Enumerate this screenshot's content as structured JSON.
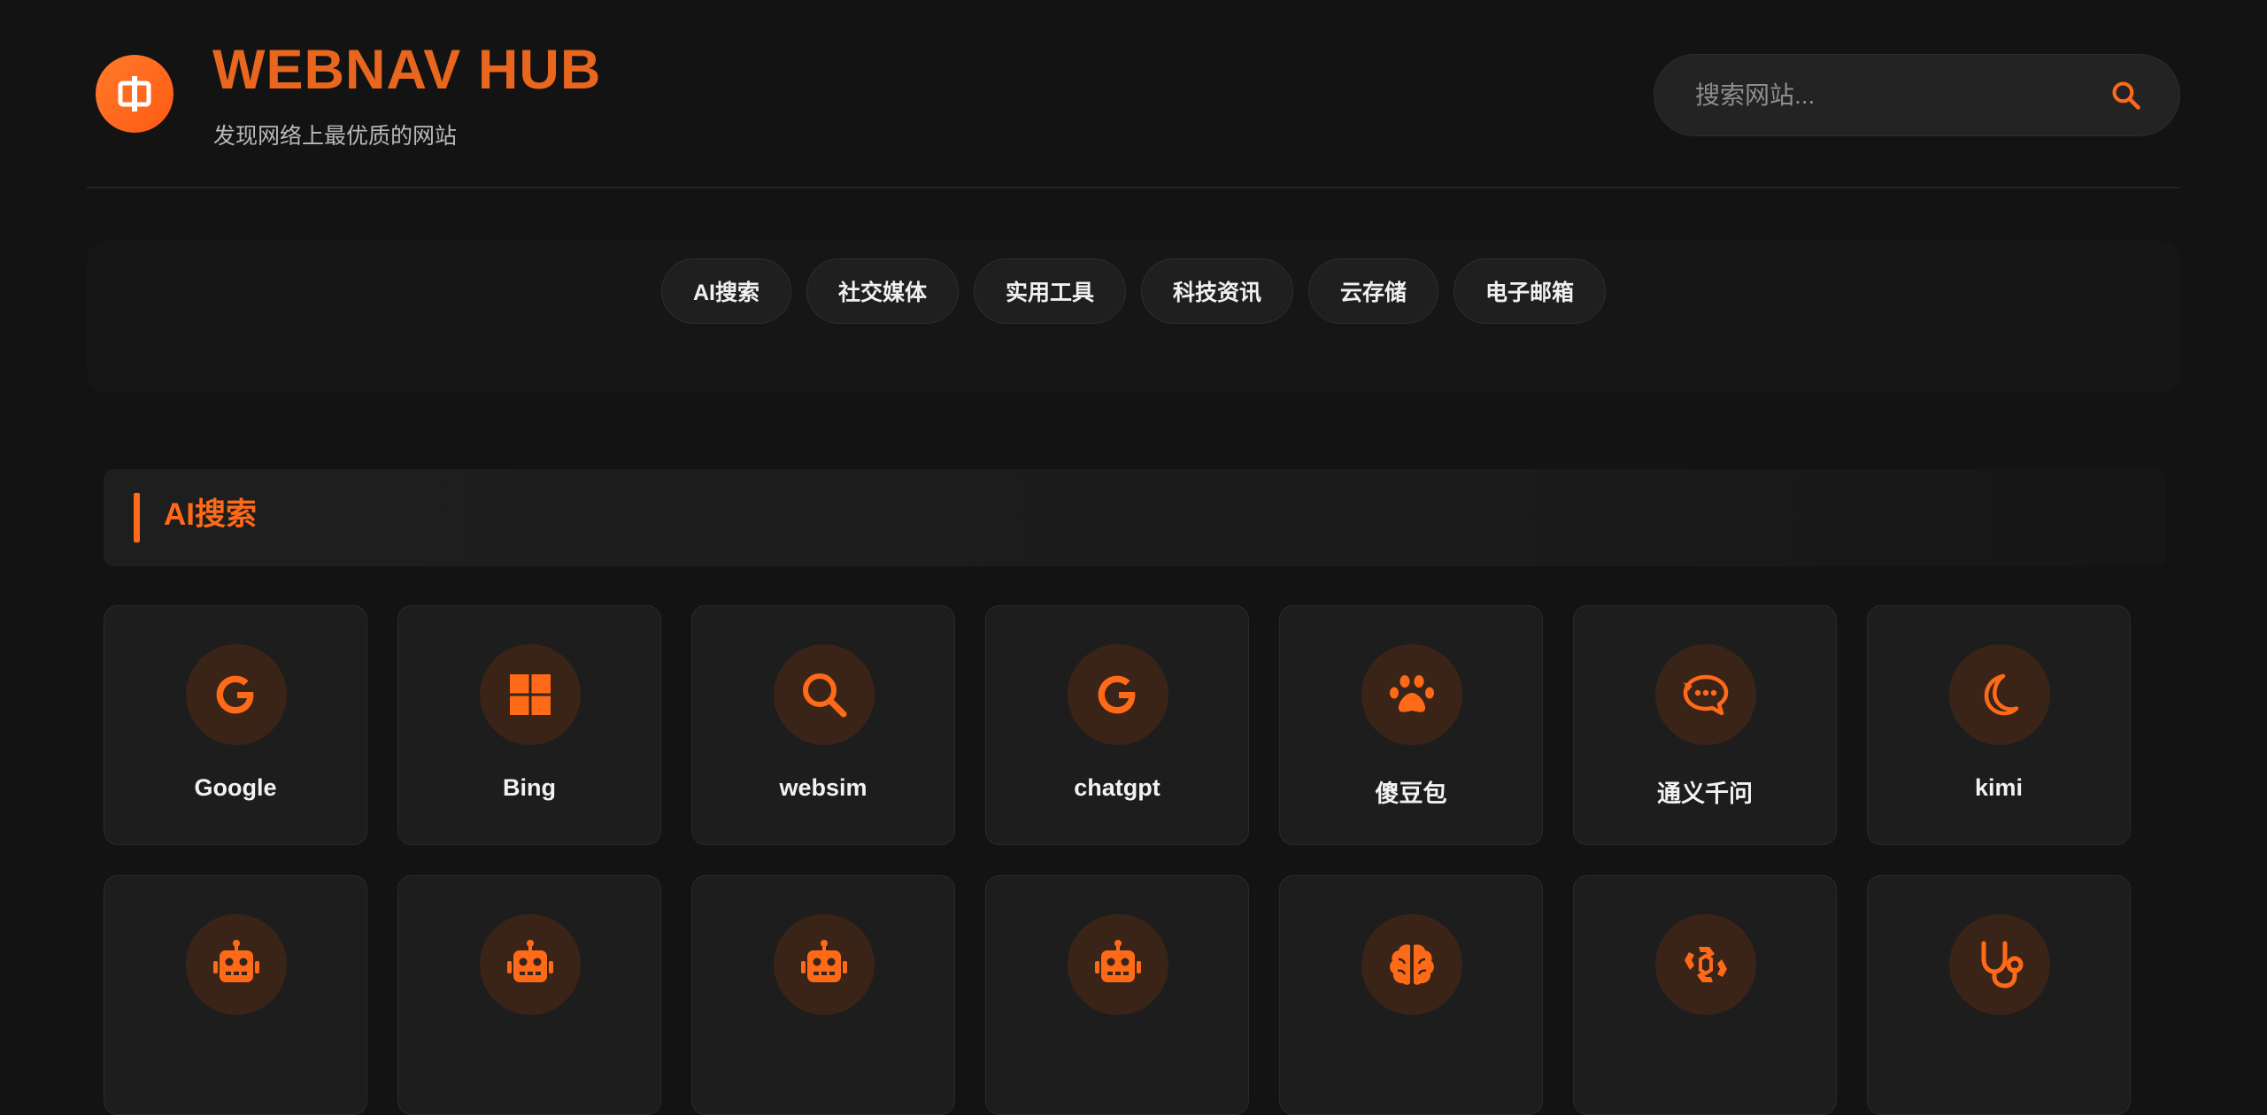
{
  "header": {
    "title": "WEBNAV HUB",
    "subtitle": "发现网络上最优质的网站",
    "logo_icon": "box-plus-icon"
  },
  "search": {
    "placeholder": "搜索网站...",
    "value": "",
    "icon": "search-icon"
  },
  "categories": [
    {
      "label": "AI搜索"
    },
    {
      "label": "社交媒体"
    },
    {
      "label": "实用工具"
    },
    {
      "label": "科技资讯"
    },
    {
      "label": "云存储"
    },
    {
      "label": "电子邮箱"
    }
  ],
  "section": {
    "title": "AI搜索"
  },
  "sites": [
    {
      "label": "Google",
      "icon": "google-icon"
    },
    {
      "label": "Bing",
      "icon": "windows-icon"
    },
    {
      "label": "websim",
      "icon": "search-icon"
    },
    {
      "label": "chatgpt",
      "icon": "google-icon"
    },
    {
      "label": "傻豆包",
      "icon": "paw-icon"
    },
    {
      "label": "通义千问",
      "icon": "chat-bubble-icon"
    },
    {
      "label": "kimi",
      "icon": "moon-icon"
    },
    {
      "label": "",
      "icon": "robot-icon"
    },
    {
      "label": "",
      "icon": "robot-icon"
    },
    {
      "label": "",
      "icon": "robot-icon"
    },
    {
      "label": "",
      "icon": "robot-icon"
    },
    {
      "label": "",
      "icon": "brain-icon"
    },
    {
      "label": "",
      "icon": "recycle-icon"
    },
    {
      "label": "",
      "icon": "stethoscope-icon"
    }
  ],
  "colors": {
    "accent": "#ff6a18",
    "background": "#131313",
    "card": "#1d1d1d",
    "icon_circle": "#3a2418"
  }
}
